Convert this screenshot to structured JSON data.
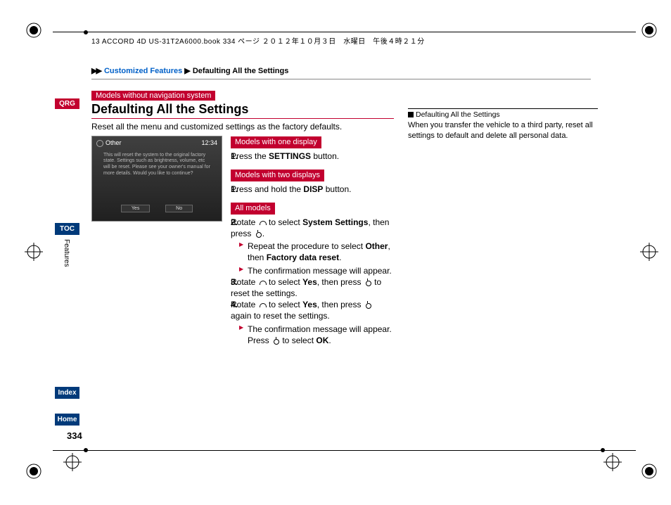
{
  "header": {
    "print_info": "13 ACCORD 4D US-31T2A6000.book  334 ページ  ２０１２年１０月３日　水曜日　午後４時２１分"
  },
  "breadcrumb": {
    "arrows": "▶▶",
    "link1": "Customized Features",
    "arrow2": "▶",
    "link2": "Defaulting All the Settings"
  },
  "sidenav": {
    "qrg": "QRG",
    "toc": "TOC",
    "index": "Index",
    "home": "Home",
    "tab": "Features"
  },
  "page_number": "334",
  "main": {
    "tag_top": "Models without navigation system",
    "title": "Defaulting All the Settings",
    "intro": "Reset all the menu and customized settings as the factory defaults.",
    "screenshot": {
      "category": "Other",
      "clock": "12:34",
      "message": "This will reset the system to the original factory state. Settings such as brightness, volume, etc will be reset. Please see your owner's manual for more details. Would you like to continue?",
      "yes": "Yes",
      "no": "No"
    },
    "sect1": {
      "tag": "Models with one display",
      "step1_num": "1.",
      "step1_a": "Press the ",
      "step1_b": "SETTINGS",
      "step1_c": " button."
    },
    "sect2": {
      "tag": "Models with two displays",
      "step1_num": "1.",
      "step1_a": "Press and hold the ",
      "step1_b": "DISP",
      "step1_c": " button."
    },
    "sect3": {
      "tag": "All models",
      "s2_num": "2.",
      "s2_a": "Rotate ",
      "s2_b": " to select ",
      "s2_c": "System Settings",
      "s2_d": ", then press ",
      "s2_e": ".",
      "s2_sub1_a": "Repeat the procedure to select ",
      "s2_sub1_b": "Other",
      "s2_sub1_c": ", then ",
      "s2_sub1_d": "Factory data reset",
      "s2_sub1_e": ".",
      "s2_sub2": "The confirmation message will appear.",
      "s3_num": "3.",
      "s3_a": "Rotate ",
      "s3_b": " to select ",
      "s3_c": "Yes",
      "s3_d": ", then press ",
      "s3_e": " to reset the settings.",
      "s4_num": "4.",
      "s4_a": "Rotate ",
      "s4_b": " to select ",
      "s4_c": "Yes",
      "s4_d": ", then press ",
      "s4_e": " again to reset the settings.",
      "s4_sub1": "The confirmation message will appear. Press ",
      "s4_sub1_b": " to select ",
      "s4_sub1_c": "OK",
      "s4_sub1_d": "."
    }
  },
  "sidebar": {
    "head": "Defaulting All the Settings",
    "body": "When you transfer the vehicle to a third party, reset all settings to default and delete all personal data."
  }
}
